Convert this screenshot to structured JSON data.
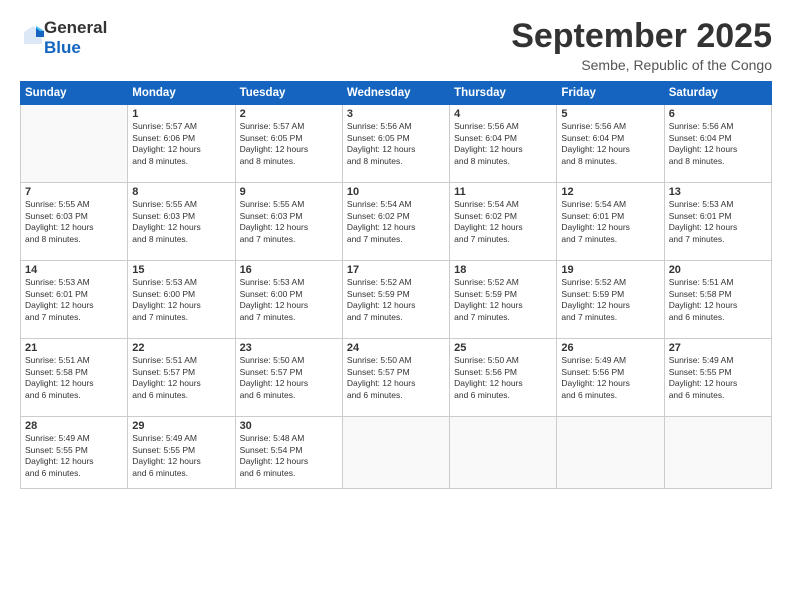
{
  "logo": {
    "general": "General",
    "blue": "Blue"
  },
  "title": "September 2025",
  "subtitle": "Sembe, Republic of the Congo",
  "headers": [
    "Sunday",
    "Monday",
    "Tuesday",
    "Wednesday",
    "Thursday",
    "Friday",
    "Saturday"
  ],
  "weeks": [
    [
      {
        "day": "",
        "info": ""
      },
      {
        "day": "1",
        "info": "Sunrise: 5:57 AM\nSunset: 6:06 PM\nDaylight: 12 hours\nand 8 minutes."
      },
      {
        "day": "2",
        "info": "Sunrise: 5:57 AM\nSunset: 6:05 PM\nDaylight: 12 hours\nand 8 minutes."
      },
      {
        "day": "3",
        "info": "Sunrise: 5:56 AM\nSunset: 6:05 PM\nDaylight: 12 hours\nand 8 minutes."
      },
      {
        "day": "4",
        "info": "Sunrise: 5:56 AM\nSunset: 6:04 PM\nDaylight: 12 hours\nand 8 minutes."
      },
      {
        "day": "5",
        "info": "Sunrise: 5:56 AM\nSunset: 6:04 PM\nDaylight: 12 hours\nand 8 minutes."
      },
      {
        "day": "6",
        "info": "Sunrise: 5:56 AM\nSunset: 6:04 PM\nDaylight: 12 hours\nand 8 minutes."
      }
    ],
    [
      {
        "day": "7",
        "info": "Sunrise: 5:55 AM\nSunset: 6:03 PM\nDaylight: 12 hours\nand 8 minutes."
      },
      {
        "day": "8",
        "info": "Sunrise: 5:55 AM\nSunset: 6:03 PM\nDaylight: 12 hours\nand 8 minutes."
      },
      {
        "day": "9",
        "info": "Sunrise: 5:55 AM\nSunset: 6:03 PM\nDaylight: 12 hours\nand 7 minutes."
      },
      {
        "day": "10",
        "info": "Sunrise: 5:54 AM\nSunset: 6:02 PM\nDaylight: 12 hours\nand 7 minutes."
      },
      {
        "day": "11",
        "info": "Sunrise: 5:54 AM\nSunset: 6:02 PM\nDaylight: 12 hours\nand 7 minutes."
      },
      {
        "day": "12",
        "info": "Sunrise: 5:54 AM\nSunset: 6:01 PM\nDaylight: 12 hours\nand 7 minutes."
      },
      {
        "day": "13",
        "info": "Sunrise: 5:53 AM\nSunset: 6:01 PM\nDaylight: 12 hours\nand 7 minutes."
      }
    ],
    [
      {
        "day": "14",
        "info": "Sunrise: 5:53 AM\nSunset: 6:01 PM\nDaylight: 12 hours\nand 7 minutes."
      },
      {
        "day": "15",
        "info": "Sunrise: 5:53 AM\nSunset: 6:00 PM\nDaylight: 12 hours\nand 7 minutes."
      },
      {
        "day": "16",
        "info": "Sunrise: 5:53 AM\nSunset: 6:00 PM\nDaylight: 12 hours\nand 7 minutes."
      },
      {
        "day": "17",
        "info": "Sunrise: 5:52 AM\nSunset: 5:59 PM\nDaylight: 12 hours\nand 7 minutes."
      },
      {
        "day": "18",
        "info": "Sunrise: 5:52 AM\nSunset: 5:59 PM\nDaylight: 12 hours\nand 7 minutes."
      },
      {
        "day": "19",
        "info": "Sunrise: 5:52 AM\nSunset: 5:59 PM\nDaylight: 12 hours\nand 7 minutes."
      },
      {
        "day": "20",
        "info": "Sunrise: 5:51 AM\nSunset: 5:58 PM\nDaylight: 12 hours\nand 6 minutes."
      }
    ],
    [
      {
        "day": "21",
        "info": "Sunrise: 5:51 AM\nSunset: 5:58 PM\nDaylight: 12 hours\nand 6 minutes."
      },
      {
        "day": "22",
        "info": "Sunrise: 5:51 AM\nSunset: 5:57 PM\nDaylight: 12 hours\nand 6 minutes."
      },
      {
        "day": "23",
        "info": "Sunrise: 5:50 AM\nSunset: 5:57 PM\nDaylight: 12 hours\nand 6 minutes."
      },
      {
        "day": "24",
        "info": "Sunrise: 5:50 AM\nSunset: 5:57 PM\nDaylight: 12 hours\nand 6 minutes."
      },
      {
        "day": "25",
        "info": "Sunrise: 5:50 AM\nSunset: 5:56 PM\nDaylight: 12 hours\nand 6 minutes."
      },
      {
        "day": "26",
        "info": "Sunrise: 5:49 AM\nSunset: 5:56 PM\nDaylight: 12 hours\nand 6 minutes."
      },
      {
        "day": "27",
        "info": "Sunrise: 5:49 AM\nSunset: 5:55 PM\nDaylight: 12 hours\nand 6 minutes."
      }
    ],
    [
      {
        "day": "28",
        "info": "Sunrise: 5:49 AM\nSunset: 5:55 PM\nDaylight: 12 hours\nand 6 minutes."
      },
      {
        "day": "29",
        "info": "Sunrise: 5:49 AM\nSunset: 5:55 PM\nDaylight: 12 hours\nand 6 minutes."
      },
      {
        "day": "30",
        "info": "Sunrise: 5:48 AM\nSunset: 5:54 PM\nDaylight: 12 hours\nand 6 minutes."
      },
      {
        "day": "",
        "info": ""
      },
      {
        "day": "",
        "info": ""
      },
      {
        "day": "",
        "info": ""
      },
      {
        "day": "",
        "info": ""
      }
    ]
  ]
}
